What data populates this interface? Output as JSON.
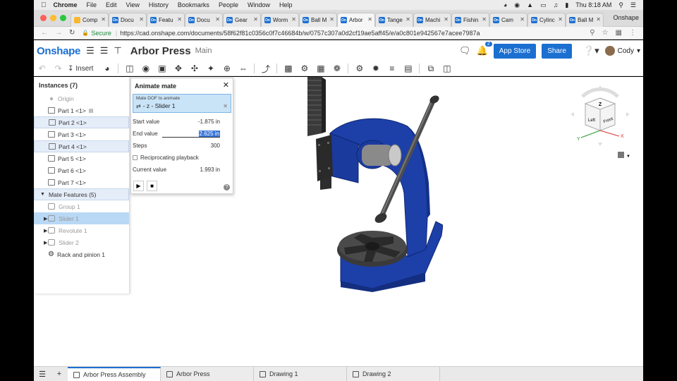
{
  "menubar": {
    "items": [
      "Chrome",
      "File",
      "Edit",
      "View",
      "History",
      "Bookmarks",
      "People",
      "Window",
      "Help"
    ],
    "clock": "Thu 8:18 AM"
  },
  "browser": {
    "tabs": [
      {
        "label": "Comp",
        "fav": "#f7b731",
        "fav_text": ""
      },
      {
        "label": "Docu",
        "fav": "#1b6fd1",
        "fav_text": "On"
      },
      {
        "label": "Featu",
        "fav": "#1b6fd1",
        "fav_text": "On"
      },
      {
        "label": "Docu",
        "fav": "#1b6fd1",
        "fav_text": "On"
      },
      {
        "label": "Gear",
        "fav": "#1b6fd1",
        "fav_text": "On"
      },
      {
        "label": "Worm",
        "fav": "#1b6fd1",
        "fav_text": "On"
      },
      {
        "label": "Ball M",
        "fav": "#1b6fd1",
        "fav_text": "On"
      },
      {
        "label": "Arbor",
        "fav": "#1b6fd1",
        "fav_text": "On",
        "active": true
      },
      {
        "label": "Tange",
        "fav": "#1b6fd1",
        "fav_text": "On"
      },
      {
        "label": "Machi",
        "fav": "#1b6fd1",
        "fav_text": "On"
      },
      {
        "label": "Fishin",
        "fav": "#1b6fd1",
        "fav_text": "On"
      },
      {
        "label": "Cam",
        "fav": "#1b6fd1",
        "fav_text": "On"
      },
      {
        "label": "Cylinc",
        "fav": "#1b6fd1",
        "fav_text": "On"
      },
      {
        "label": "Ball M",
        "fav": "#1b6fd1",
        "fav_text": "On"
      }
    ],
    "profile": "Onshape",
    "secure_label": "Secure",
    "url": "https://cad.onshape.com/documents/58f62f81c0356c0f7c46684b/w/0757c307a0d2cf19ae5aff45/e/a0c801e942567e7acee7987a"
  },
  "header": {
    "logo": "Onshape",
    "doc_title": "Arbor Press",
    "workspace": "Main",
    "notif_count": "2",
    "app_store": "App Store",
    "share": "Share",
    "user": "Cody"
  },
  "toolbar": {
    "insert_label": "Insert"
  },
  "instances": {
    "title": "Instances (7)",
    "origin": "Origin",
    "parts": [
      "Part 1 <1>",
      "Part 2 <1>",
      "Part 3 <1>",
      "Part 4 <1>",
      "Part 5 <1>",
      "Part 6 <1>",
      "Part 7 <1>"
    ],
    "mate_features": "Mate Features (5)",
    "mates": [
      "Group 1",
      "Slider 1",
      "Revolute 1",
      "Slider 2",
      "Rack and pinion 1"
    ]
  },
  "animate": {
    "title": "Animate mate",
    "dof_label": "Mate DOF to animate",
    "dof_value": "- z - Slider 1",
    "start_label": "Start value",
    "start_value": "-1.875 in",
    "end_label": "End value",
    "end_value": "2.625 in",
    "steps_label": "Steps",
    "steps_value": "300",
    "recip_label": "Reciprocating playback",
    "current_label": "Current value",
    "current_value": "1.993 in"
  },
  "viewcube": {
    "top": "Z",
    "left": "Left",
    "front": "Front",
    "axis_x": "X",
    "axis_y": "Y"
  },
  "bottom_tabs": [
    {
      "label": "Arbor Press Assembly",
      "active": true
    },
    {
      "label": "Arbor Press"
    },
    {
      "label": "Drawing 1"
    },
    {
      "label": "Drawing 2"
    }
  ],
  "colors": {
    "accent": "#1b6fd1",
    "part_blue": "#1d3fa8",
    "selection": "#b8d8f5"
  }
}
